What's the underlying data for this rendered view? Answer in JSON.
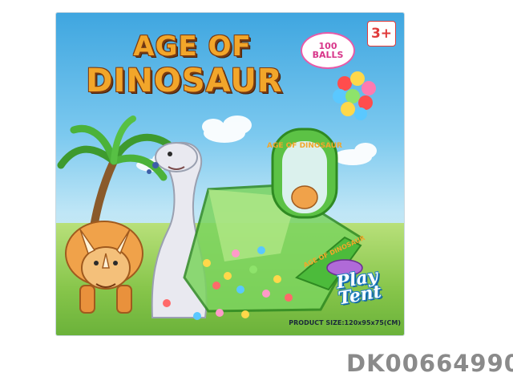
{
  "box": {
    "title_line1": "AGE OF",
    "title_line2": "DINOSAUR",
    "balls_badge": "100 BALLS",
    "age_badge": "3+",
    "logo_text": "Play Tent",
    "product_size": "PRODUCT SIZE:120x95x75(CM)",
    "tent_label_top": "AGE OF DINOSAUR",
    "tent_label_side": "AGE OF DINOSAUR"
  },
  "sku": "DK00664990",
  "colors": {
    "sky": "#3fa6e0",
    "grass": "#86c54a",
    "title": "#f2a62a",
    "tent_green": "#4cbb3b"
  },
  "icons": [
    "palm-tree-icon",
    "cloud-icon",
    "triceratops-icon",
    "sauropod-icon",
    "play-tent-icon",
    "ball-icon"
  ]
}
